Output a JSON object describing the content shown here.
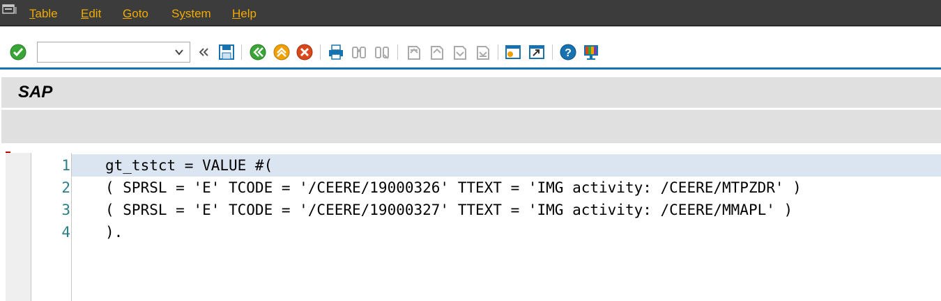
{
  "menubar": {
    "items": [
      {
        "mnemonic": "T",
        "rest": "able"
      },
      {
        "mnemonic": "E",
        "rest": "dit"
      },
      {
        "mnemonic": "G",
        "rest": "oto"
      },
      {
        "mnemonic": "",
        "rest": "System",
        "underline_index": 1
      },
      {
        "mnemonic": "H",
        "rest": "elp"
      }
    ],
    "system_pre": "S",
    "system_mn": "y",
    "system_post": "stem"
  },
  "toolbar": {
    "command_field_value": "",
    "icons": [
      "enter-icon",
      "command-field",
      "collapse-icon",
      "save-icon",
      "back-icon",
      "exit-icon",
      "cancel-icon",
      "print-icon",
      "find-icon",
      "find-next-icon",
      "first-page-icon",
      "previous-page-icon",
      "next-page-icon",
      "last-page-icon",
      "create-session-icon",
      "shortcut-icon",
      "help-icon",
      "customize-layout-icon"
    ],
    "colors": {
      "accent": "#1872b0",
      "enter_green": "#3aa537",
      "exit_orange": "#f0a000",
      "cancel_red": "#d9471b"
    }
  },
  "title": "SAP",
  "editor": {
    "lines": [
      {
        "num": "1",
        "text": "gt_tstct = VALUE #("
      },
      {
        "num": "2",
        "text": "( SPRSL = 'E' TCODE = '/CEERE/19000326' TTEXT = 'IMG activity: /CEERE/MTPZDR' )"
      },
      {
        "num": "3",
        "text": "( SPRSL = 'E' TCODE = '/CEERE/19000327' TTEXT = 'IMG activity: /CEERE/MMAPL' )"
      },
      {
        "num": "4",
        "text": ")."
      }
    ]
  }
}
